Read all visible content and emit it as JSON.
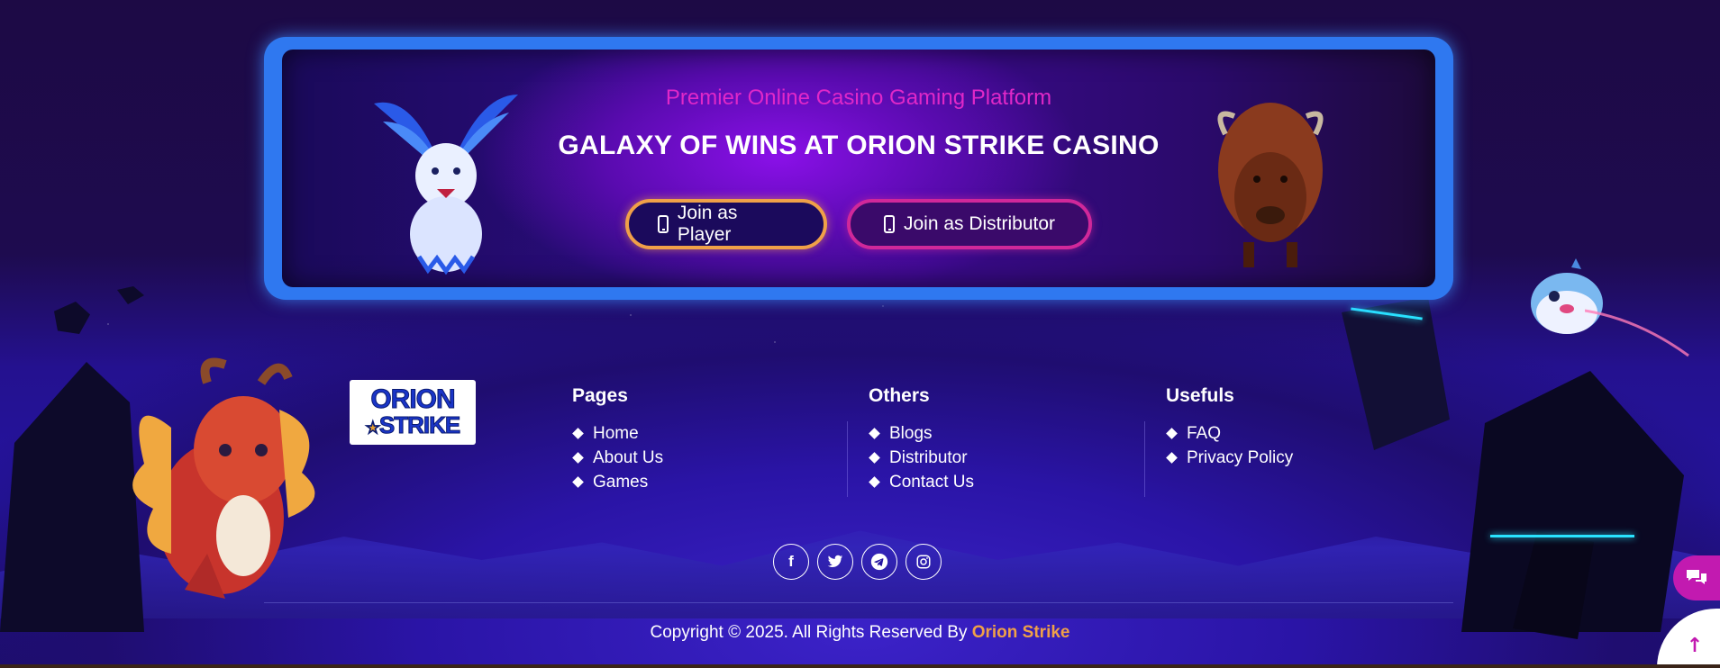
{
  "banner": {
    "subtitle": "Premier Online Casino Gaming Platform",
    "headline": "GALAXY OF WINS AT ORION STRIKE CASINO",
    "player_button": "Join as Player",
    "distributor_button": "Join as Distributor"
  },
  "logo": {
    "line1": "ORION",
    "line2": "STRIKE"
  },
  "columns": {
    "pages": {
      "title": "Pages",
      "items": [
        "Home",
        "About Us",
        "Games"
      ]
    },
    "others": {
      "title": "Others",
      "items": [
        "Blogs",
        "Distributor",
        "Contact Us"
      ]
    },
    "usefuls": {
      "title": "Usefuls",
      "items": [
        "FAQ",
        "Privacy Policy"
      ]
    }
  },
  "social": {
    "facebook": "f",
    "twitter": "twitter-icon",
    "telegram": "telegram-icon",
    "instagram": "instagram-icon"
  },
  "footer": {
    "copyright": "Copyright © 2025. All Rights Reserved By ",
    "brand": "Orion Strike"
  },
  "colors": {
    "accent_orange": "#f0a048",
    "accent_magenta": "#c21ab0",
    "banner_border": "#2f78f0",
    "subtitle_pink": "#e028c8"
  }
}
